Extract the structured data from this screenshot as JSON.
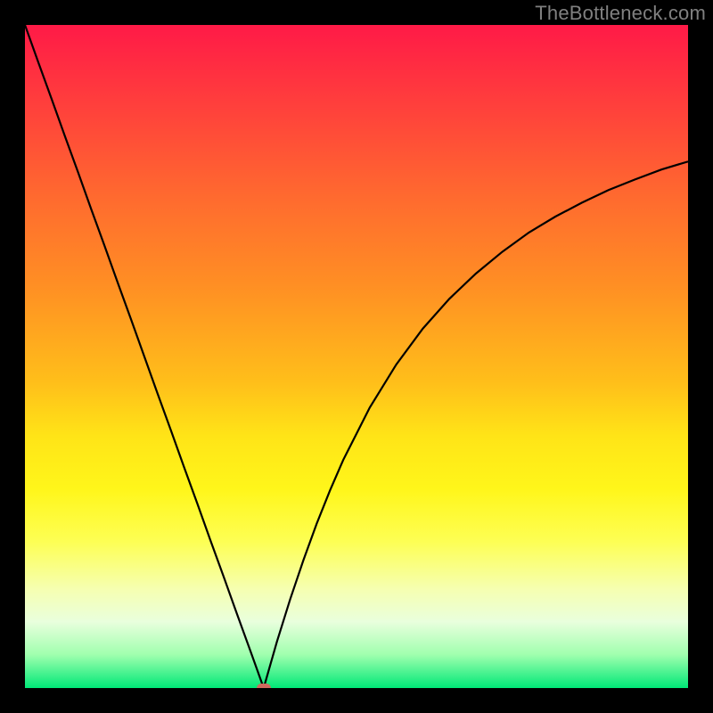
{
  "watermark": "TheBottleneck.com",
  "colors": {
    "frame": "#000000",
    "watermark": "#808080",
    "curve": "#000000",
    "marker": "#cf6a5e",
    "gradient_stops": [
      {
        "pos": 0.0,
        "hex": "#ff1a47"
      },
      {
        "pos": 0.12,
        "hex": "#ff3f3c"
      },
      {
        "pos": 0.26,
        "hex": "#ff6a2f"
      },
      {
        "pos": 0.4,
        "hex": "#ff9123"
      },
      {
        "pos": 0.54,
        "hex": "#ffbf1a"
      },
      {
        "pos": 0.62,
        "hex": "#ffe417"
      },
      {
        "pos": 0.7,
        "hex": "#fff61a"
      },
      {
        "pos": 0.78,
        "hex": "#fdff55"
      },
      {
        "pos": 0.85,
        "hex": "#f6ffb0"
      },
      {
        "pos": 0.9,
        "hex": "#e9ffdd"
      },
      {
        "pos": 0.95,
        "hex": "#9fffae"
      },
      {
        "pos": 1.0,
        "hex": "#00e877"
      }
    ]
  },
  "chart_data": {
    "type": "line",
    "title": "",
    "xlabel": "",
    "ylabel": "",
    "xlim": [
      0,
      100
    ],
    "ylim": [
      0,
      100
    ],
    "x_min_at": 36,
    "marker": {
      "x": 36,
      "y": 0
    },
    "series": [
      {
        "name": "curve",
        "x": [
          0,
          2,
          4,
          6,
          8,
          10,
          12,
          14,
          16,
          18,
          20,
          22,
          24,
          26,
          28,
          30,
          32,
          34,
          35,
          36,
          37,
          38,
          40,
          42,
          44,
          46,
          48,
          52,
          56,
          60,
          64,
          68,
          72,
          76,
          80,
          84,
          88,
          92,
          96,
          100
        ],
        "y": [
          100,
          94.4,
          88.9,
          83.3,
          77.8,
          72.2,
          66.7,
          61.1,
          55.6,
          50.0,
          44.4,
          38.9,
          33.3,
          27.8,
          22.2,
          16.7,
          11.1,
          5.6,
          2.8,
          0.0,
          3.5,
          7.0,
          13.4,
          19.3,
          24.8,
          29.8,
          34.4,
          42.3,
          48.8,
          54.2,
          58.7,
          62.5,
          65.8,
          68.7,
          71.1,
          73.2,
          75.1,
          76.7,
          78.2,
          79.4
        ]
      }
    ]
  }
}
